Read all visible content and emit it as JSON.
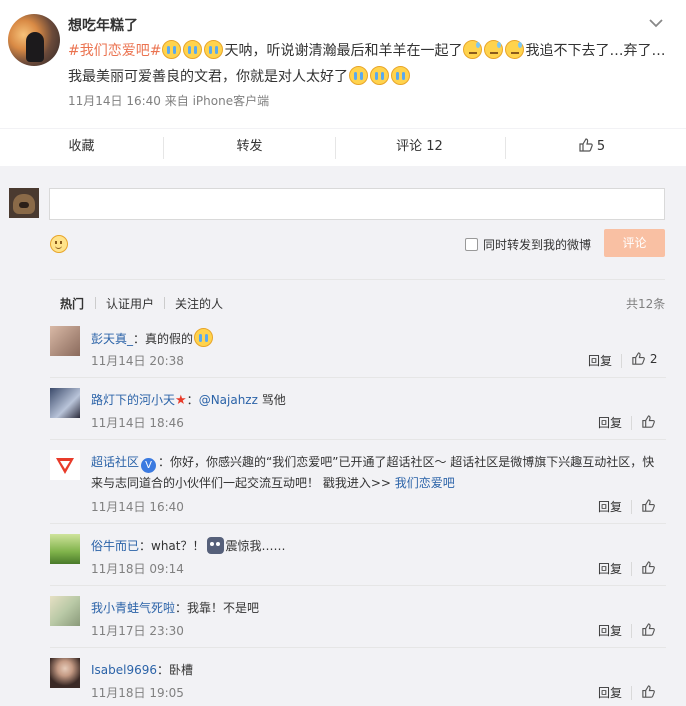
{
  "post": {
    "username": "想吃年糕了",
    "hashtag": "#我们恋爱吧#",
    "text_part1": "天呐，听说谢清瀚最后和羊羊在一起了",
    "text_part2": "我追不下去了…弃了…我最美丽可爱善良的文君，你就是对人太好了",
    "time": "11月14日 16:40",
    "source": "来自 iPhone客户端",
    "emojis": [
      "cry-emoji",
      "sweat-emoji"
    ]
  },
  "actions": {
    "collect": "收藏",
    "forward": "转发",
    "comment": "评论 12",
    "like_count": "5"
  },
  "composer": {
    "placeholder": "",
    "forward_label": "同时转发到我的微博",
    "submit_label": "评论"
  },
  "filters": {
    "hot": "热门",
    "verified": "认证用户",
    "following": "关注的人",
    "total": "共12条"
  },
  "comments": [
    {
      "name": "彭天真_",
      "text": "：真的假的",
      "time": "11月14日 20:38",
      "reply": "回复",
      "likes": "2"
    },
    {
      "name": "路灯下的河小天",
      "mention": "@Najahzz",
      "text": "骂他",
      "time": "11月14日 18:46",
      "reply": "回复"
    },
    {
      "name": "超话社区",
      "text_a": "：你好，你感兴趣的“我们恋爱吧”已开通了超话社区～ 超话社区是微博旗下兴趣互动社区，快来与志同道合的小伙伴们一起交流互动吧！ 戳我进入>>",
      "link": "我们恋爱吧",
      "time": "11月14日 16:40",
      "reply": "回复"
    },
    {
      "name": "俗牛而已",
      "text_a": "：what？！",
      "text_b": "震惊我……",
      "time": "11月18日 09:14",
      "reply": "回复"
    },
    {
      "name": "我小青蛙气死啦",
      "text": "：我靠！不是吧",
      "time": "11月17日 23:30",
      "reply": "回复"
    },
    {
      "name": "Isabel9696",
      "text": "：卧槽",
      "time": "11月18日 19:05",
      "reply": "回复"
    }
  ],
  "colors": {
    "accent": "#eb7350",
    "link_blue": "#2b63a8",
    "background_gray": "#f2f2f5",
    "submit_disabled": "#f9c0a3"
  }
}
